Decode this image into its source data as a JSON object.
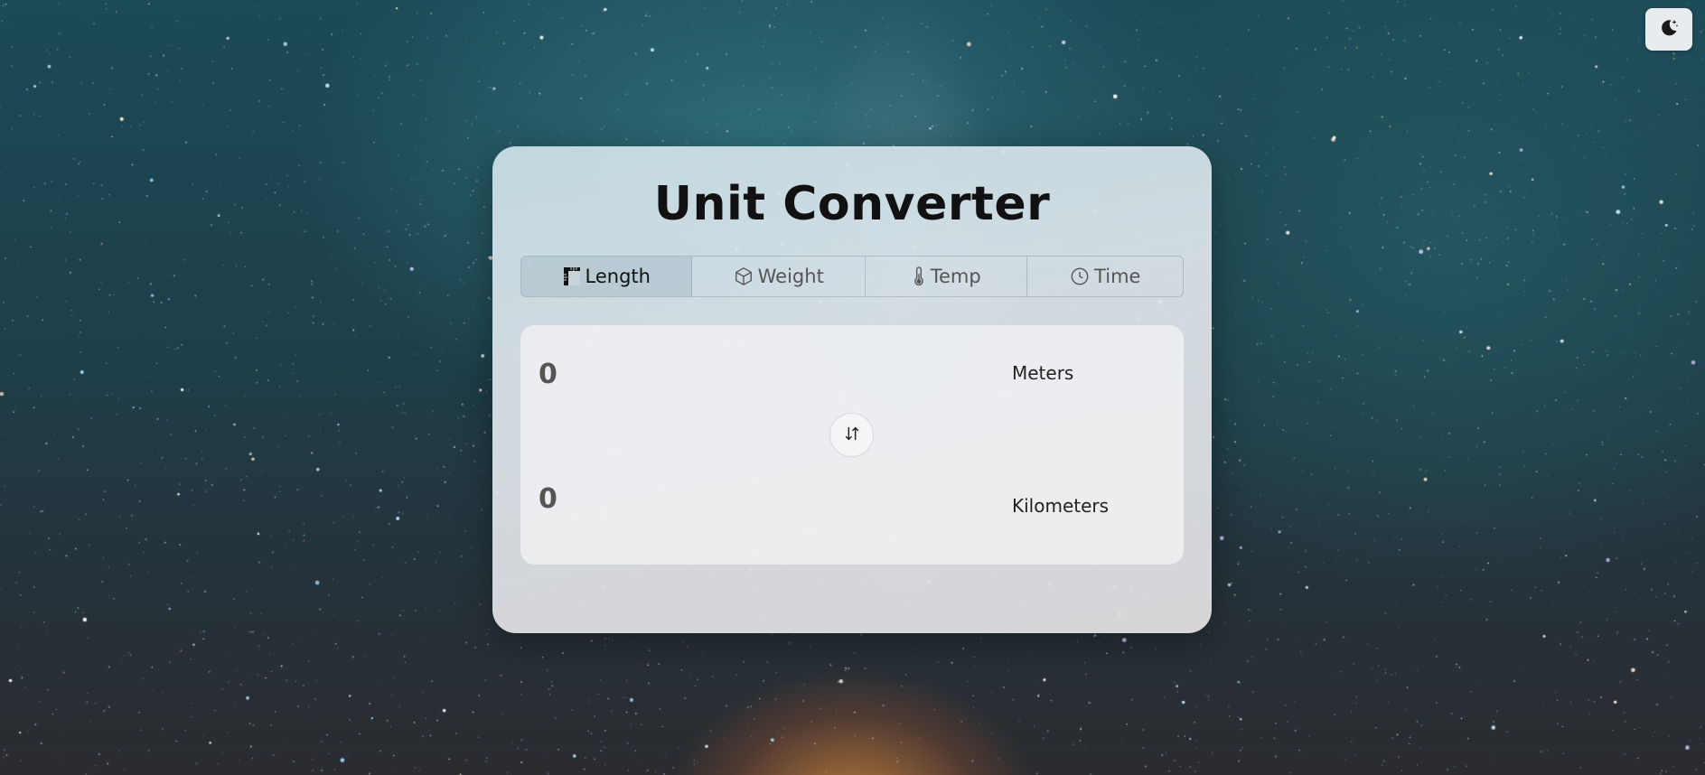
{
  "app": {
    "title": "Unit Converter"
  },
  "theme_toggle": {
    "icon": "moon-stars-icon"
  },
  "tabs": [
    {
      "label": "Length",
      "icon": "ruler-icon",
      "active": true
    },
    {
      "label": "Weight",
      "icon": "cube-icon",
      "active": false
    },
    {
      "label": "Temp",
      "icon": "thermometer-icon",
      "active": false
    },
    {
      "label": "Time",
      "icon": "clock-icon",
      "active": false
    }
  ],
  "converter": {
    "from_value": "0",
    "from_unit": "Meters",
    "to_value": "0",
    "to_unit": "Kilometers",
    "swap_icon": "swap-arrows-icon"
  },
  "colors": {
    "title": "#111111",
    "active_tab_bg": "#96afb9"
  }
}
